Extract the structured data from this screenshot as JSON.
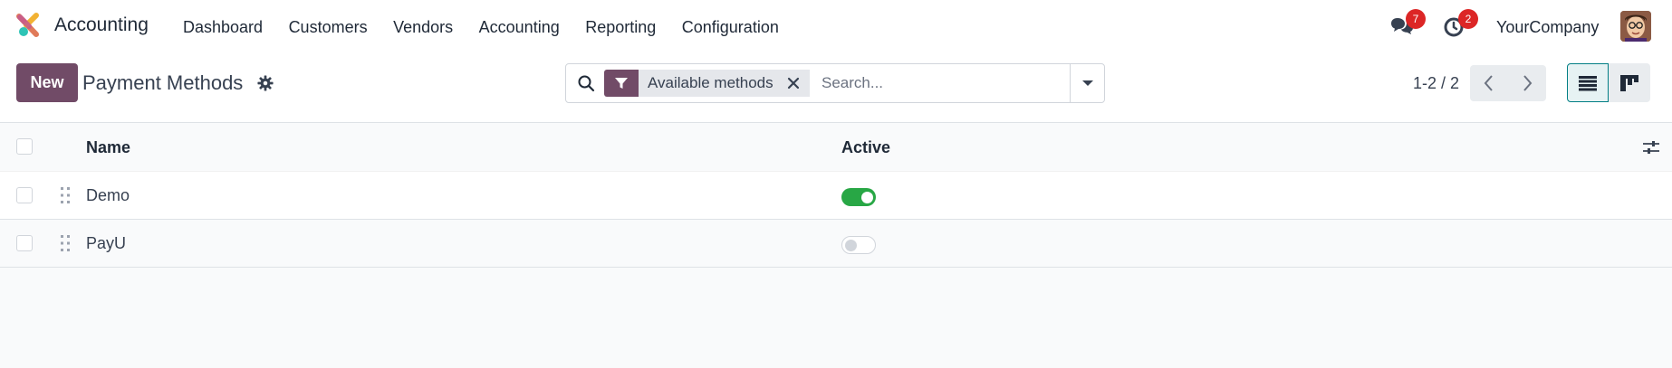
{
  "navbar": {
    "app_name": "Accounting",
    "menu": [
      "Dashboard",
      "Customers",
      "Vendors",
      "Accounting",
      "Reporting",
      "Configuration"
    ],
    "messages_count": "7",
    "activities_count": "2",
    "company": "YourCompany"
  },
  "control_panel": {
    "new_label": "New",
    "title": "Payment Methods",
    "facet_label": "Available methods",
    "search_placeholder": "Search...",
    "pager": "1-2 / 2"
  },
  "list": {
    "columns": {
      "name": "Name",
      "active": "Active"
    },
    "rows": [
      {
        "name": "Demo",
        "active": true
      },
      {
        "name": "PayU",
        "active": false
      }
    ]
  },
  "colors": {
    "brand": "#714b67",
    "toggle_on": "#28a745",
    "badge": "#dc2626",
    "view_active_border": "#017e84"
  }
}
